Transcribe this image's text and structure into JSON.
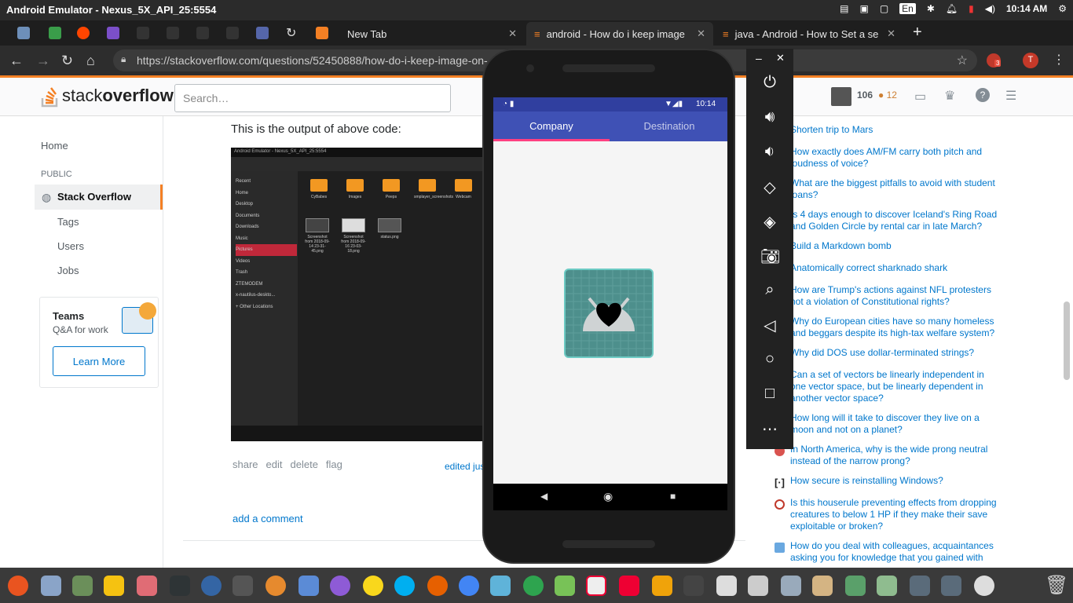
{
  "system_bar": {
    "window_title": "Android Emulator - Nexus_5X_API_25:5554",
    "lang": "En",
    "clock": "10:14 AM"
  },
  "browser": {
    "tabs": [
      {
        "label": "New Tab"
      },
      {
        "label": "android - How do i keep image"
      },
      {
        "label": "java - Android - How to Set a se"
      }
    ],
    "url": "https://stackoverflow.com/questions/52450888/how-do-i-keep-image-on-",
    "profile_initial": "T",
    "ext_badge": "3"
  },
  "so": {
    "logo_plain": "stack",
    "logo_bold": "overflow",
    "search_placeholder": "Search…",
    "rep": "106",
    "bronze": "● 12",
    "nav": {
      "home": "Home",
      "public": "PUBLIC",
      "stackoverflow": "Stack Overflow",
      "tags": "Tags",
      "users": "Users",
      "jobs": "Jobs"
    },
    "teams": {
      "title": "Teams",
      "subtitle": "Q&A for work",
      "button": "Learn More"
    },
    "post": {
      "caption": "This is the output of above code:",
      "share": "share",
      "edit": "edit",
      "delete": "delete",
      "flag": "flag",
      "edited": "edited jus",
      "add_comment": "add a comment"
    },
    "screenshot": {
      "title": "Android Emulator - Nexus_5X_API_25:5554",
      "side": [
        "Recent",
        "Home",
        "Desktop",
        "Documents",
        "Downloads",
        "Music",
        "Pictures",
        "Videos",
        "Trash",
        "ZTEMODEM",
        "x-nautilus-deskto...",
        "+ Other Locations"
      ],
      "folders": [
        "CyBabes",
        "Images",
        "Peeps",
        "smplayer_screenshots",
        "Webcam"
      ],
      "files": [
        "Screenshot from 2018-09-14 23-31-45.png",
        "Screenshot from 2018-09-16 23-03-18.png",
        "status.png"
      ]
    },
    "hot_questions": [
      "Shorten trip to Mars",
      "How exactly does AM/FM carry both pitch and loudness of voice?",
      "What are the biggest pitfalls to avoid with student loans?",
      "Is 4 days enough to discover Iceland's Ring Road and Golden Circle by rental car in late March?",
      "Build a Markdown bomb",
      "Anatomically correct sharknado shark",
      "How are Trump's actions against NFL protesters not a violation of Constitutional rights?",
      "Why do European cities have so many homeless and beggars despite its high-tax welfare system?",
      "Why did DOS use dollar-terminated strings?",
      "Can a set of vectors be linearly independent in one vector space, but be linearly dependent in another vector space?",
      "How long will it take to discover they live on a moon and not on a planet?",
      "In North America, why is the wide prong neutral instead of the narrow prong?",
      "How secure is reinstalling Windows?",
      "Is this houserule preventing effects from dropping creatures to below 1 HP if they make their save exploitable or broken?",
      "How do you deal with colleagues, acquaintances asking you for knowledge that you gained with"
    ]
  },
  "phone": {
    "time": "10:14",
    "tab_company": "Company",
    "tab_destination": "Destination"
  }
}
